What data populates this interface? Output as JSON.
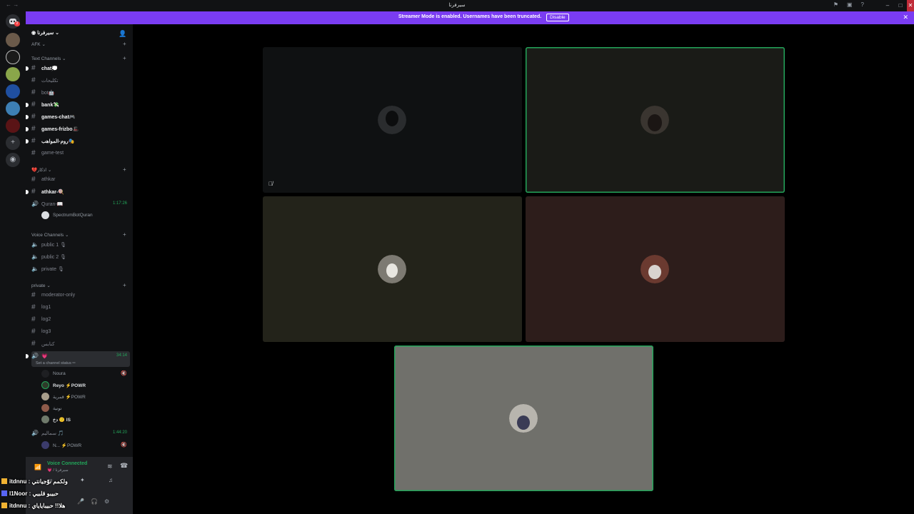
{
  "window": {
    "title": "سيرفرنا",
    "back": "←",
    "forward": "→",
    "title_icons": [
      "flag-icon",
      "inbox-icon",
      "help-icon"
    ],
    "controls": {
      "minimize": "–",
      "maximize": "□",
      "close": "✕"
    }
  },
  "banner": {
    "message": "Streamer Mode is enabled. Usernames have been truncated.",
    "disable_label": "Disable",
    "close": "✕"
  },
  "server_list": {
    "add_label": "+",
    "discover_label": "◉",
    "mention_badge": "2"
  },
  "guild": {
    "name": "سيرفرنا",
    "afk_label": "AFK"
  },
  "categories": {
    "text": "Text Channels",
    "athkar": "اذكار",
    "voice": "Voice Channels",
    "private": "private"
  },
  "text_channels": [
    {
      "name": "chat💭",
      "unread": true
    },
    {
      "name": "تكليحات",
      "unread": false
    },
    {
      "name": "bot🤖",
      "unread": false
    },
    {
      "name": "bank💸",
      "unread": true
    },
    {
      "name": "games-chat🎮",
      "unread": true
    },
    {
      "name": "games-frizbo🎩",
      "unread": true
    },
    {
      "name": "روم-المواهب🎭",
      "unread": true
    },
    {
      "name": "game-test",
      "unread": false
    }
  ],
  "athkar_channels": [
    {
      "name": "athkar",
      "unread": false
    },
    {
      "name": "athkar-🍭",
      "unread": true
    }
  ],
  "quran_voice": {
    "name": "Quran-📖",
    "timer": "1:17:26",
    "user": "SpectrumBotQuran"
  },
  "voice_channels": [
    {
      "name": "public 1 🎙"
    },
    {
      "name": "public 2 🎙"
    },
    {
      "name": "private 🎙"
    }
  ],
  "private_channels": [
    {
      "name": "moderator-only"
    },
    {
      "name": "log1"
    },
    {
      "name": "log2"
    },
    {
      "name": "log3"
    },
    {
      "name": "كنابس"
    }
  ],
  "active_voice": {
    "name": "💗",
    "timer": "34:14",
    "status_prompt": "Set a channel status ✏",
    "users": [
      {
        "name": "Noura",
        "bold": false,
        "tag": "",
        "icon": "🔇"
      },
      {
        "name": "Reyo ⚡POWR",
        "bold": true,
        "tag": "",
        "icon": ""
      },
      {
        "name": "قمرية ⚡POWR",
        "bold": false,
        "tag": "",
        "icon": ""
      },
      {
        "name": "نونية",
        "bold": false,
        "tag": "",
        "icon": ""
      },
      {
        "name": "دخ 🙂 IS",
        "bold": true,
        "tag": "",
        "icon": ""
      }
    ]
  },
  "second_voice": {
    "name": "سماليم 🎵",
    "timer": "1:44:20",
    "users": [
      {
        "name": "N... ⚡POWR",
        "icon": "🔇"
      }
    ]
  },
  "voice_status": {
    "title": "Voice Connected",
    "subtitle": "💗 / سيرفرنا"
  },
  "overlay_chat": [
    {
      "user": "itdnnu",
      "text": "ولكمم نوّجيانتي",
      "badge_color": "#f0b232"
    },
    {
      "user": "l1Noor",
      "text": "حبيبو قلبيي",
      "badge_color": "#5865f2"
    },
    {
      "user": "itdnnu",
      "text": "هلا!! حبيباياياي",
      "badge_color": "#f0b232"
    }
  ],
  "tiles": [
    {
      "bg": "#0f1112",
      "speaking": false,
      "muted": true,
      "avatar_color": "#2a2c2e",
      "avatar_accent": "#0c0d0e"
    },
    {
      "bg": "#1a1b17",
      "speaking": true,
      "muted": false,
      "avatar_color": "#3a3530",
      "avatar_accent": "#1b1614"
    },
    {
      "bg": "#23231a",
      "speaking": false,
      "muted": false,
      "avatar_color": "#7d7a72",
      "avatar_accent": "#e8e6e0"
    },
    {
      "bg": "#2d1d1b",
      "speaking": false,
      "muted": false,
      "avatar_color": "#6b3a30",
      "avatar_accent": "#d9d3cf"
    },
    {
      "bg": "#70706b",
      "speaking": true,
      "muted": false,
      "avatar_color": "#b8b5ae",
      "avatar_accent": "#3a3b55"
    }
  ],
  "colors": {
    "accent": "#7a3cf2",
    "speaking": "#23a55a",
    "background": "#000000"
  }
}
